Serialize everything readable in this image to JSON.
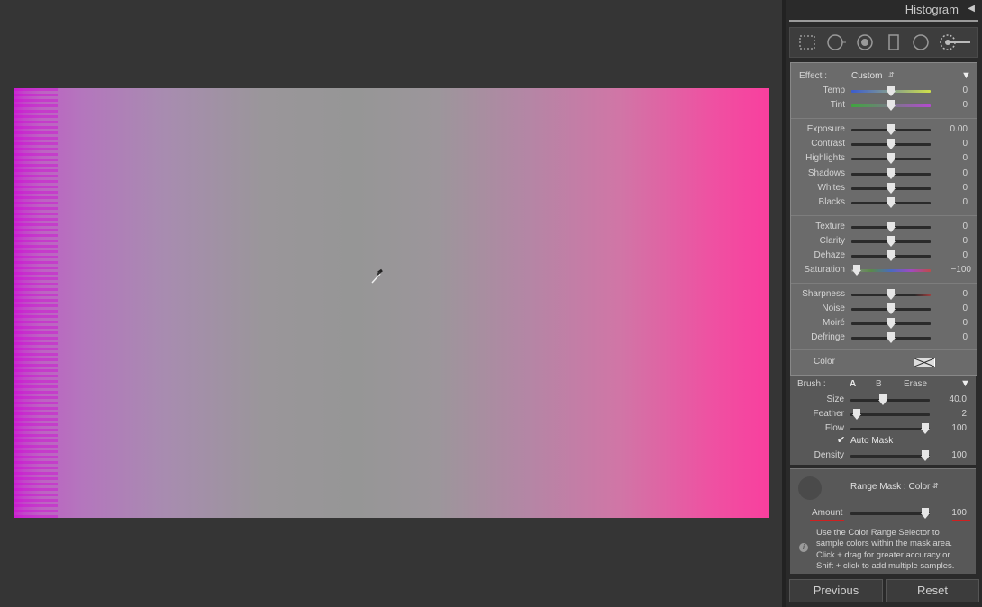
{
  "panel": {
    "histogram_title": "Histogram",
    "effect": {
      "label": "Effect :",
      "value": "Custom"
    },
    "sliders_group1": [
      {
        "label": "Temp",
        "value": "0"
      },
      {
        "label": "Tint",
        "value": "0"
      }
    ],
    "sliders_group2": [
      {
        "label": "Exposure",
        "value": "0.00"
      },
      {
        "label": "Contrast",
        "value": "0"
      },
      {
        "label": "Highlights",
        "value": "0"
      },
      {
        "label": "Shadows",
        "value": "0"
      },
      {
        "label": "Whites",
        "value": "0"
      },
      {
        "label": "Blacks",
        "value": "0"
      }
    ],
    "sliders_group3": [
      {
        "label": "Texture",
        "value": "0"
      },
      {
        "label": "Clarity",
        "value": "0"
      },
      {
        "label": "Dehaze",
        "value": "0"
      },
      {
        "label": "Saturation",
        "value": "−100"
      }
    ],
    "sliders_group4": [
      {
        "label": "Sharpness",
        "value": "0"
      },
      {
        "label": "Noise",
        "value": "0"
      },
      {
        "label": "Moiré",
        "value": "0"
      },
      {
        "label": "Defringe",
        "value": "0"
      }
    ],
    "color_label": "Color",
    "brush": {
      "label": "Brush :",
      "a": "A",
      "b": "B",
      "erase": "Erase",
      "sliders": [
        {
          "label": "Size",
          "value": "40.0"
        },
        {
          "label": "Feather",
          "value": "2"
        },
        {
          "label": "Flow",
          "value": "100"
        }
      ],
      "auto_mask": "Auto Mask",
      "density": {
        "label": "Density",
        "value": "100"
      }
    },
    "range_mask": {
      "label": "Range Mask : Color",
      "amount_label": "Amount",
      "amount_value": "100",
      "help_text": [
        "Use the Color Range Selector to",
        "sample colors within the mask area.",
        "Click + drag for greater accuracy or",
        "Shift + click to add multiple samples."
      ]
    },
    "buttons": {
      "previous": "Previous",
      "reset": "Reset"
    }
  }
}
